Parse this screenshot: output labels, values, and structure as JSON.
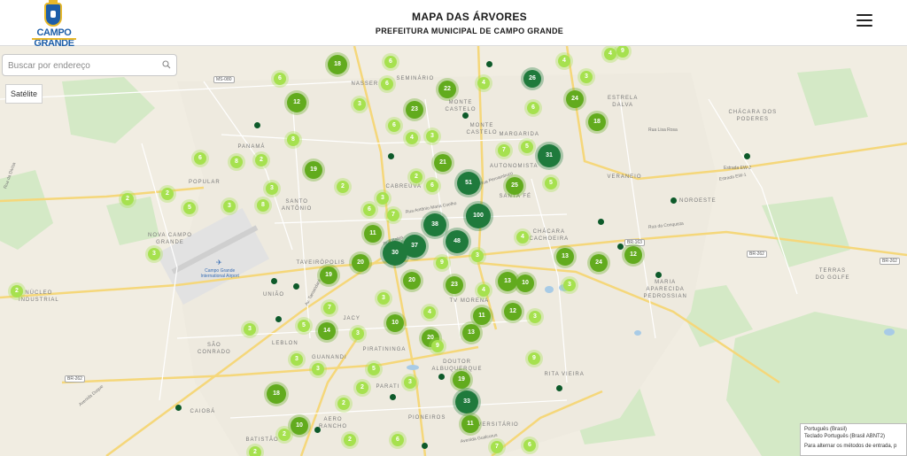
{
  "header": {
    "logo_text": "CAMPO GRANDE",
    "title": "MAPA DAS ÁRVORES",
    "subtitle": "PREFEITURA MUNICIPAL DE CAMPO GRANDE"
  },
  "search": {
    "placeholder": "Buscar por endereço"
  },
  "map_type_button": "Satélite",
  "colors": {
    "cluster_small": "#a6e14f",
    "cluster_medium": "#62ab1e",
    "cluster_large": "#1f7a3c",
    "single_tree": "#0d5a2a"
  },
  "neighborhoods": [
    "NASSER",
    "SEMINÁRIO",
    "ESTRELA\nDALVA",
    "CHÁCARA DOS\nPODERES",
    "MONTE\nCASTELO",
    "MONTE\nCASTELO",
    "MARGARIDA",
    "PANAMÁ",
    "POPULAR",
    "AUTONOMISTA",
    "CABREÚVA",
    "VERANEIO",
    "SANTO\nANTÔNIO",
    "SANTA FÉ",
    "NOROESTE",
    "NOVA CAMPO\nGRANDE",
    "CHÁCARA\nCACHOEIRA",
    "TAVEIRÓPOLIS",
    "UNIÃO",
    "TERRAS\nDO GOLFE",
    "MARIA\nAPARECIDA\nPEDROSSIAN",
    "NÚCLEO\nINDUSTRIAL",
    "TV MORENA",
    "JACY",
    "SÃO\nCONRADO",
    "LEBLON",
    "PIRATININGA",
    "GUANANDI",
    "DOUTOR\nALBUQUERQUE",
    "RITA VIEIRA",
    "PARATI",
    "CAIOBÁ",
    "AERO\nRANCHO",
    "PIONEIROS",
    "UNIVERSITÁRIO",
    "BATISTÃO"
  ],
  "roads": [
    "Rua Antônio Maria Coelho",
    "Rua Pernambuco",
    "Rua Lisa Rosa",
    "Estrada EW-1",
    "Estrada EW-2",
    "Rua da Conquista",
    "Rua Bahia",
    "Av. Tamandaré",
    "Avenida Duque",
    "Avenida Gualcurus",
    "Rua da Divisa"
  ],
  "shields": [
    "MS-080",
    "BR-163",
    "BR-262",
    "BR-262",
    "BR-262"
  ],
  "airport_label": "Campo Grande\nInternational Airport",
  "clusters": [
    {
      "count": "18"
    },
    {
      "count": "6"
    },
    {
      "count": "4"
    },
    {
      "count": "9"
    },
    {
      "count": "4"
    },
    {
      "count": "6"
    },
    {
      "count": "6"
    },
    {
      "count": "22"
    },
    {
      "count": "4"
    },
    {
      "count": "26"
    },
    {
      "count": "3"
    },
    {
      "count": "12"
    },
    {
      "count": "3"
    },
    {
      "count": "6"
    },
    {
      "count": "23"
    },
    {
      "count": "6"
    },
    {
      "count": "24"
    },
    {
      "count": "18"
    },
    {
      "count": "3"
    },
    {
      "count": "4"
    },
    {
      "count": "8"
    },
    {
      "count": "6"
    },
    {
      "count": "8"
    },
    {
      "count": "2"
    },
    {
      "count": "31"
    },
    {
      "count": "7"
    },
    {
      "count": "5"
    },
    {
      "count": "2"
    },
    {
      "count": "19"
    },
    {
      "count": "21"
    },
    {
      "count": "3"
    },
    {
      "count": "2"
    },
    {
      "count": "6"
    },
    {
      "count": "51"
    },
    {
      "count": "25"
    },
    {
      "count": "5"
    },
    {
      "count": "2"
    },
    {
      "count": "5"
    },
    {
      "count": "3"
    },
    {
      "count": "8"
    },
    {
      "count": "3"
    },
    {
      "count": "6"
    },
    {
      "count": "7"
    },
    {
      "count": "38"
    },
    {
      "count": "100"
    },
    {
      "count": "11"
    },
    {
      "count": "37"
    },
    {
      "count": "48"
    },
    {
      "count": "3"
    },
    {
      "count": "4"
    },
    {
      "count": "30"
    },
    {
      "count": "20"
    },
    {
      "count": "9"
    },
    {
      "count": "3"
    },
    {
      "count": "13"
    },
    {
      "count": "24"
    },
    {
      "count": "12"
    },
    {
      "count": "19"
    },
    {
      "count": "20"
    },
    {
      "count": "23"
    },
    {
      "count": "13"
    },
    {
      "count": "10"
    },
    {
      "count": "4"
    },
    {
      "count": "3"
    },
    {
      "count": "2"
    },
    {
      "count": "2"
    },
    {
      "count": "7"
    },
    {
      "count": "4"
    },
    {
      "count": "11"
    },
    {
      "count": "12"
    },
    {
      "count": "3"
    },
    {
      "count": "10"
    },
    {
      "count": "3"
    },
    {
      "count": "14"
    },
    {
      "count": "5"
    },
    {
      "count": "3"
    },
    {
      "count": "13"
    },
    {
      "count": "20"
    },
    {
      "count": "9"
    },
    {
      "count": "3"
    },
    {
      "count": "3"
    },
    {
      "count": "9"
    },
    {
      "count": "5"
    },
    {
      "count": "19"
    },
    {
      "count": "3"
    },
    {
      "count": "2"
    },
    {
      "count": "18"
    },
    {
      "count": "33"
    },
    {
      "count": "2"
    },
    {
      "count": "11"
    },
    {
      "count": "10"
    },
    {
      "count": "2"
    },
    {
      "count": "7"
    },
    {
      "count": "6"
    },
    {
      "count": "2"
    },
    {
      "count": "2"
    },
    {
      "count": "6"
    },
    {
      "count": "3"
    }
  ],
  "ime_popup": {
    "line1": "Português (Brasil)",
    "line2": "Teclado Português (Brasil ABNT2)",
    "line3": "Para alternar os métodos de entrada, p"
  }
}
